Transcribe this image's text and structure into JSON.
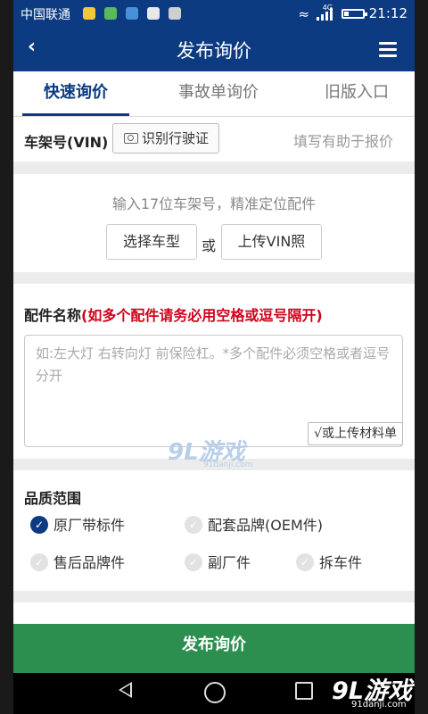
{
  "statusbar": {
    "carrier": "中国联通",
    "network": "4G",
    "time": "21:12"
  },
  "header": {
    "title": "发布询价"
  },
  "tabs": [
    {
      "label": "快速询价",
      "active": true
    },
    {
      "label": "事故单询价",
      "active": false
    },
    {
      "label": "旧版入口",
      "active": false
    }
  ],
  "vin": {
    "label": "车架号(VIN)",
    "scan_label": "识别行驶证",
    "hint": "填写有助于报价",
    "tip": "输入17位车架号，精准定位配件",
    "select_model": "选择车型",
    "or": "或",
    "upload_vin": "上传VIN照"
  },
  "parts": {
    "title": "配件名称",
    "title_note": "(如多个配件请务必用空格或逗号隔开)",
    "placeholder": "如:左大灯 右转向灯 前保险杠。*多个配件必须空格或者逗号分开",
    "upload_label": "√或上传材料单"
  },
  "quality": {
    "title": "品质范围",
    "options": [
      {
        "label": "原厂带标件",
        "checked": true
      },
      {
        "label": "配套品牌(OEM件)",
        "checked": false
      },
      {
        "label": "售后品牌件",
        "checked": false
      },
      {
        "label": "副厂件",
        "checked": false
      },
      {
        "label": "拆车件",
        "checked": false
      }
    ]
  },
  "publish_label": "发布询价",
  "watermark": {
    "logo_text": "9L游戏",
    "site": "91danji.com"
  },
  "colors": {
    "primary": "#0d3b82",
    "publish": "#2c8f4f",
    "required": "#d0021b"
  }
}
